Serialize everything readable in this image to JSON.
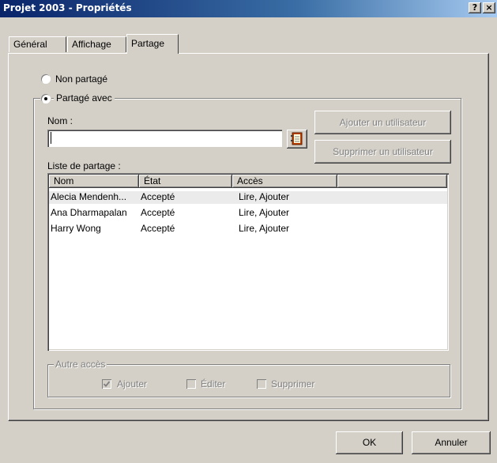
{
  "window": {
    "title": "Projet 2003 - Propriétés",
    "help_button": "?",
    "close_button": "×"
  },
  "tabs": [
    {
      "label": "Général",
      "active": false
    },
    {
      "label": "Affichage",
      "active": false
    },
    {
      "label": "Partage",
      "active": true
    }
  ],
  "sharing": {
    "option_not_shared": "Non partagé",
    "option_shared_with": "Partagé avec",
    "selected_option": "Partagé avec",
    "name_label": "Nom :",
    "name_value": "",
    "add_user_button": "Ajouter un utilisateur",
    "remove_user_button": "Supprimer un utilisateur",
    "share_list_label": "Liste de partage :",
    "columns": [
      "Nom",
      "État",
      "Accès",
      ""
    ],
    "rows": [
      {
        "name": "Alecia Mendenh...",
        "state": "Accepté",
        "access": "Lire, Ajouter",
        "selected": true
      },
      {
        "name": "Ana Dharmapalan",
        "state": "Accepté",
        "access": "Lire, Ajouter",
        "selected": false
      },
      {
        "name": "Harry Wong",
        "state": "Accepté",
        "access": "Lire, Ajouter",
        "selected": false
      }
    ],
    "other_access": {
      "label": "Autre accès",
      "add": {
        "label": "Ajouter",
        "checked": true
      },
      "edit": {
        "label": "Éditer",
        "checked": false
      },
      "delete": {
        "label": "Supprimer",
        "checked": false
      }
    }
  },
  "footer": {
    "ok_button": "OK",
    "cancel_button": "Annuler"
  },
  "icons": {
    "address_book": "address-book-icon"
  }
}
